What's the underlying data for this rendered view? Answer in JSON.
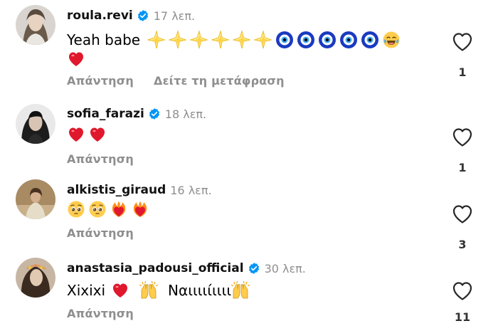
{
  "comments": [
    {
      "username": "roula.revi",
      "verified": true,
      "time": "17 λεπ.",
      "text_prefix": "Yeah babe",
      "emojis": [
        "glowing-star",
        "glowing-star",
        "glowing-star",
        "glowing-star",
        "glowing-star",
        "glowing-star",
        "nazar-amulet",
        "nazar-amulet",
        "nazar-amulet",
        "nazar-amulet",
        "nazar-amulet",
        "tears-of-joy",
        "red-heart"
      ],
      "actions": [
        "Απάντηση",
        "Δείτε τη μετάφραση"
      ],
      "likes": "1"
    },
    {
      "username": "sofia_farazi",
      "verified": true,
      "time": "18 λεπ.",
      "emojis": [
        "red-heart",
        "red-heart"
      ],
      "actions": [
        "Απάντηση"
      ],
      "likes": "1"
    },
    {
      "username": "alkistis_giraud",
      "verified": false,
      "time": "16 λεπ.",
      "emojis": [
        "pleading-face",
        "pleading-face",
        "heart-on-fire",
        "heart-on-fire"
      ],
      "actions": [
        "Απάντηση"
      ],
      "likes": "3"
    },
    {
      "username": "anastasia_padousi_official",
      "verified": true,
      "time": "30 λεπ.",
      "text_part1": "Xixixi",
      "text_part2": "Ναιιιιίιιιι",
      "emojis": [
        "red-heart",
        "raising-hands",
        "raising-hands"
      ],
      "actions": [
        "Απάντηση"
      ],
      "likes": "11"
    }
  ],
  "colors": {
    "verified": "#0095f6",
    "muted": "#8e8e8e",
    "heart": "#e0182d"
  }
}
